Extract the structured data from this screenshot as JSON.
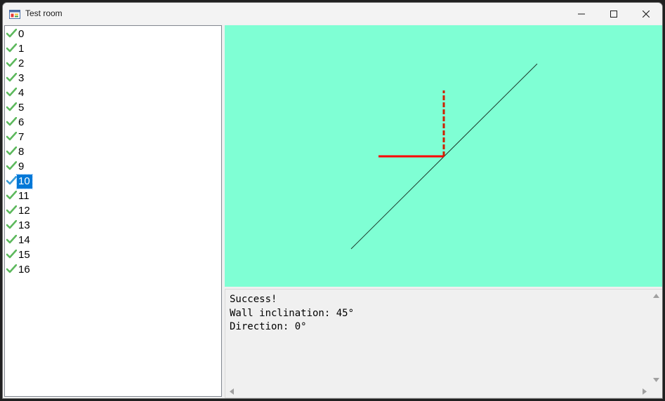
{
  "window": {
    "title": "Test room",
    "icon": "app-window-icon",
    "controls": {
      "minimize": "minimize-icon",
      "maximize": "maximize-icon",
      "close": "close-icon"
    }
  },
  "tests": {
    "selected": "10",
    "items": [
      "0",
      "1",
      "2",
      "3",
      "4",
      "5",
      "6",
      "7",
      "8",
      "9",
      "10",
      "11",
      "12",
      "13",
      "14",
      "15",
      "16"
    ],
    "status_icon": "green-check-icon",
    "status_color": "#5cb85c"
  },
  "canvas": {
    "background": "#7fffd4",
    "wall_color": "#1e3d2e",
    "incoming_color": "#ff0000",
    "outgoing_color": "#cc2200"
  },
  "output": {
    "lines": [
      "Success!",
      "Wall inclination: 45°",
      "Direction: 0°"
    ]
  }
}
